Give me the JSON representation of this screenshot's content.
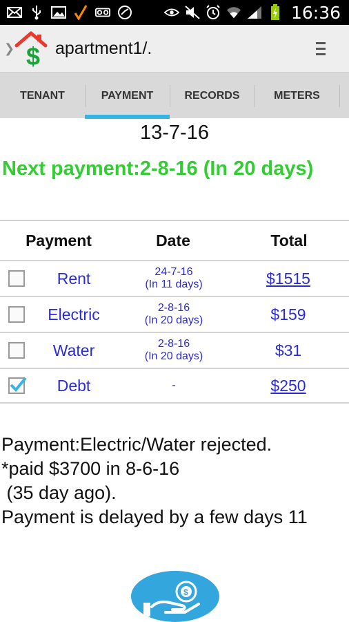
{
  "status_bar": {
    "time": "16:36",
    "icons": [
      "mail-icon",
      "usb-icon",
      "image-icon",
      "check-icon",
      "voicemail-icon",
      "sync-icon",
      "eye-icon",
      "mute-icon",
      "alarm-icon",
      "wifi-icon",
      "signal-icon",
      "battery-charging-icon"
    ]
  },
  "app_bar": {
    "title": "apartment1/.",
    "logo_icon": "house-dollar-icon",
    "menu_icon": "overflow-menu-icon"
  },
  "tabs": [
    {
      "label": "TENANT",
      "active": false
    },
    {
      "label": "PAYMENT",
      "active": true
    },
    {
      "label": "RECORDS",
      "active": false
    },
    {
      "label": "METERS",
      "active": false
    }
  ],
  "summary": {
    "date": "13-7-16",
    "next_payment": "Next payment:2-8-16 (In 20 days)"
  },
  "table": {
    "headers": {
      "payment": "Payment",
      "date": "Date",
      "total": "Total"
    },
    "rows": [
      {
        "name": "Rent",
        "date": "24-7-16",
        "due": "(In 11 days)",
        "total": "$1515",
        "checked": false
      },
      {
        "name": "Electric",
        "date": "2-8-16",
        "due": "(In 20 days)",
        "total": "$159",
        "checked": false
      },
      {
        "name": "Water",
        "date": "2-8-16",
        "due": "(In 20 days)",
        "total": "$31",
        "checked": false
      },
      {
        "name": "Debt",
        "date": "-",
        "due": "",
        "total": "$250",
        "checked": true
      }
    ]
  },
  "notes": {
    "line1": "Payment:Electric/Water rejected.",
    "line2": "*paid $3700 in 8-6-16",
    "line3": " (35 day ago).",
    "line4": "Payment is delayed by a few days 11"
  },
  "fab": {
    "icon": "pay-money-hand-icon"
  },
  "colors": {
    "accent": "#33b5e5",
    "next_payment": "#33cc33",
    "link": "#2b2bd6",
    "fab": "#33a7dd"
  }
}
